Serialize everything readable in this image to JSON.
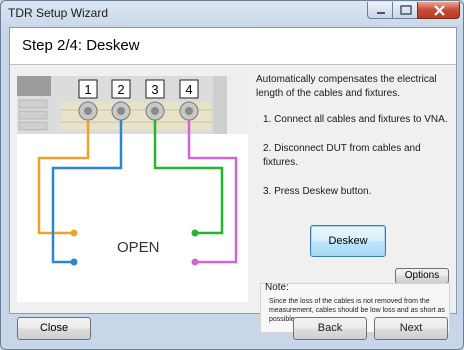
{
  "window": {
    "title": "TDR Setup Wizard"
  },
  "step": {
    "title": "Step 2/4: Deskew"
  },
  "diagram": {
    "ports": [
      "1",
      "2",
      "3",
      "4"
    ],
    "open_label": "OPEN",
    "cable_colors": [
      "#f0a12a",
      "#2b86d6",
      "#27b52c",
      "#d264d6"
    ]
  },
  "instructions": {
    "intro": "Automatically compensates the electrical length of the cables and fixtures.",
    "steps": [
      "1. Connect all cables and fixtures to VNA.",
      "2. Disconnect DUT from cables and fixtures.",
      "3. Press Deskew button."
    ]
  },
  "buttons": {
    "deskew": "Deskew",
    "options": "Options",
    "close": "Close",
    "back": "Back",
    "next": "Next"
  },
  "note": {
    "label": "Note:",
    "text": "Since the loss of the cables is not removed from the measurement, cables should be low loss and as short as possible."
  }
}
